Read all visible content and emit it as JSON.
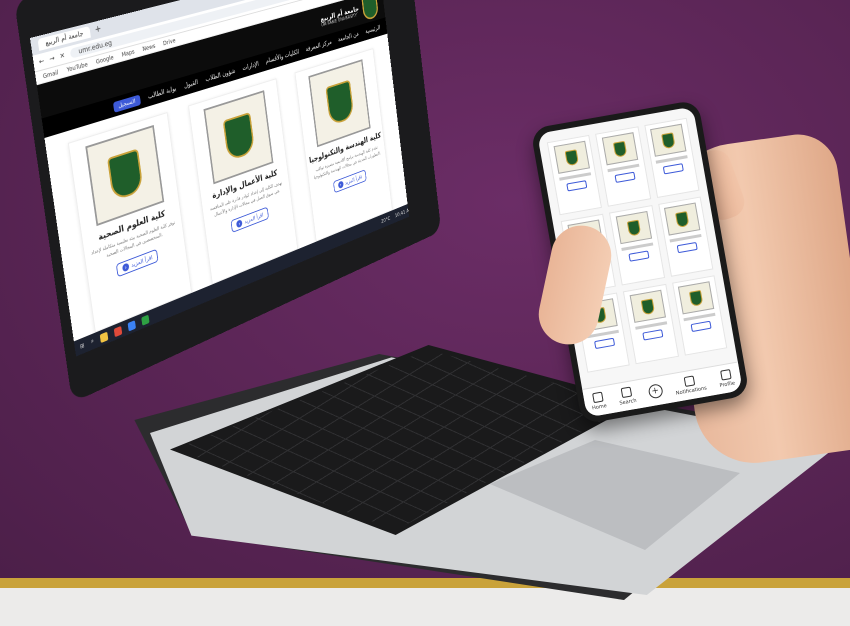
{
  "browser": {
    "tab_title": "جامعة أم الربيع",
    "url": "umr.edu.eg",
    "bookmarks": [
      "Gmail",
      "YouTube",
      "Google",
      "Maps",
      "News",
      "Drive"
    ]
  },
  "site": {
    "name": "جامعة أم الربيع",
    "subtitle": "UM RABIE UNIVERSITY",
    "nav_items": [
      "الرئيسية",
      "عن الجامعة",
      "مركز المعرفة",
      "الكليات والأقسام",
      "الإدارات",
      "شؤون الطلاب",
      "القبول",
      "بوابة الطالب",
      "خدمات عامة",
      "الاتصال بنا"
    ],
    "nav_button": "التسجيل"
  },
  "colleges": [
    {
      "title": "كلية الهندسة والتكنولوجيا",
      "description": "تقدم كلية الهندسة برامج أكاديمية متميزة تواكب التطورات الحديثة في مجالات الهندسة والتكنولوجيا.",
      "button": "اقرأ المزيد"
    },
    {
      "title": "كلية الأعمال والإدارة",
      "description": "تهدف الكلية إلى إعداد كوادر قادرة على المنافسة في سوق العمل في مجالات الإدارة والأعمال.",
      "button": "اقرأ المزيد"
    },
    {
      "title": "كلية العلوم الصحية",
      "description": "توفر كلية العلوم الصحية بيئة تعليمية متكاملة لإعداد المتخصصين في المجالات الصحية.",
      "button": "اقرأ المزيد"
    }
  ],
  "taskbar": {
    "time": "10:41 AM",
    "weather": "20°C"
  },
  "phone": {
    "bottom_nav": [
      "Home",
      "Search",
      "",
      "Notifications",
      "Profile"
    ]
  }
}
